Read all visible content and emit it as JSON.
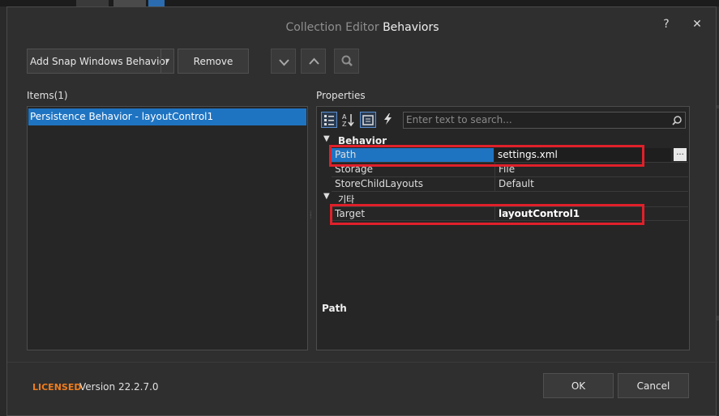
{
  "dialog": {
    "title_prefix": "Collection Editor",
    "title_main": "Behaviors",
    "help_glyph": "?",
    "close_glyph": "✕"
  },
  "toolbar": {
    "add_button_label": "Add Snap Windows Behavior",
    "add_dropdown_glyph": "▾",
    "remove_label": "Remove",
    "move_down_icon": "chevron-down-icon",
    "move_up_icon": "chevron-up-icon",
    "search_icon": "search-icon"
  },
  "items": {
    "header": "Items(1)",
    "list": [
      "Persistence Behavior - layoutControl1"
    ]
  },
  "properties": {
    "header": "Properties",
    "search_placeholder": "Enter text to search...",
    "categories": [
      {
        "name": "Behavior",
        "rows": [
          {
            "name": "Path",
            "value": "settings.xml",
            "selected": true
          },
          {
            "name": "Storage",
            "value": "File"
          },
          {
            "name": "StoreChildLayouts",
            "value": "Default"
          }
        ]
      },
      {
        "name": "기타",
        "rows": [
          {
            "name": "Target",
            "value": "layoutControl1",
            "bold": true
          }
        ]
      }
    ],
    "ellipsis_label": "...",
    "description_title": "Path"
  },
  "footer": {
    "licensed": "LICENSED",
    "version": "Version 22.2.7.0",
    "ok_label": "OK",
    "cancel_label": "Cancel"
  },
  "colors": {
    "selection": "#1f74c2",
    "highlight_box": "#e0202a",
    "licensed": "#f07d1c"
  }
}
